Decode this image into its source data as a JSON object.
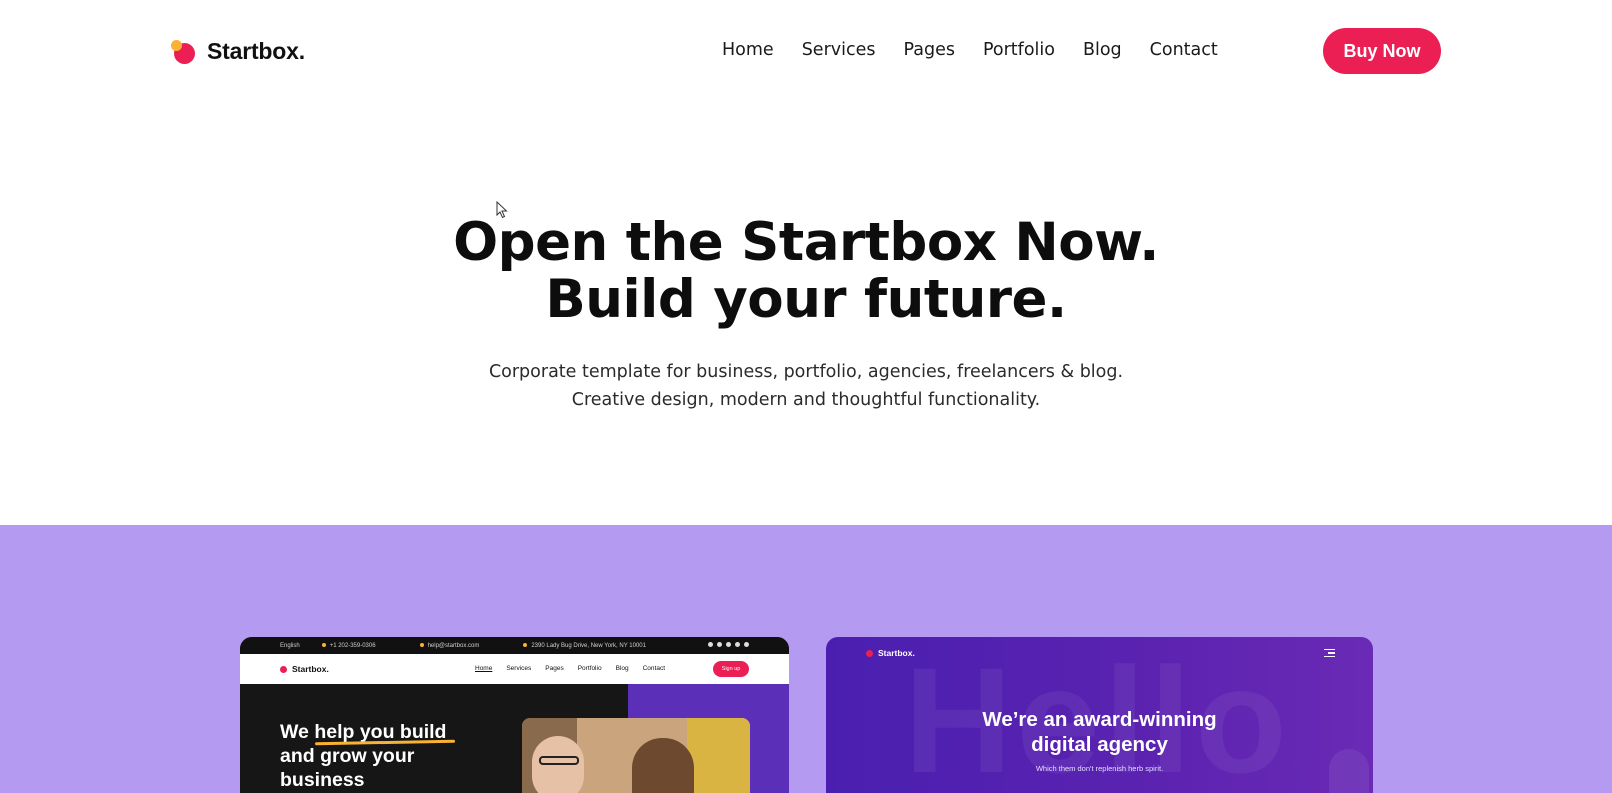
{
  "header": {
    "brand": "Startbox.",
    "nav": [
      "Home",
      "Services",
      "Pages",
      "Portfolio",
      "Blog",
      "Contact"
    ],
    "cta": "Buy Now"
  },
  "hero": {
    "title_line1": "Open the Startbox Now.",
    "title_line2": "Build your future.",
    "subtitle_line1": "Corporate template for business, portfolio, agencies, freelancers & blog.",
    "subtitle_line2": "Creative design, modern and thoughtful functionality."
  },
  "colors": {
    "accent": "#ec1f55",
    "logo_dot": "#f9b233",
    "band": "#b49af0",
    "card2_bg": "#4a1fb0"
  },
  "preview1": {
    "topbar": {
      "language": "English",
      "phone": "+1 202-359-0306",
      "email": "help@startbox.com",
      "address": "2390 Lady Bug Drive, New York, NY 10001"
    },
    "brand": "Startbox.",
    "menu": [
      "Home",
      "Services",
      "Pages",
      "Portfolio",
      "Blog",
      "Contact"
    ],
    "cta": "Sign up",
    "headline_1": "We help you build",
    "headline_2": "and grow your",
    "headline_3": "business"
  },
  "preview2": {
    "brand": "Startbox.",
    "watermark": "Hello",
    "headline_1": "We’re an award-winning",
    "headline_2": "digital agency",
    "subtitle": "Which them don't replenish herb spirit."
  }
}
